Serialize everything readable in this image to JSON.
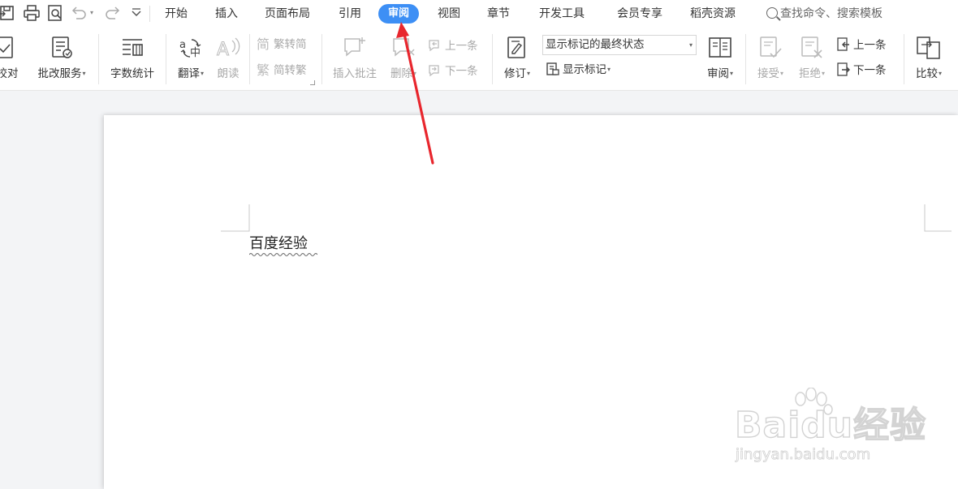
{
  "tabs": [
    {
      "label": "开始",
      "active": false
    },
    {
      "label": "插入",
      "active": false
    },
    {
      "label": "页面布局",
      "active": false
    },
    {
      "label": "引用",
      "active": false
    },
    {
      "label": "审阅",
      "active": true
    },
    {
      "label": "视图",
      "active": false
    },
    {
      "label": "章节",
      "active": false
    },
    {
      "label": "开发工具",
      "active": false
    },
    {
      "label": "会员专享",
      "active": false
    },
    {
      "label": "稻壳资源",
      "active": false
    }
  ],
  "search": {
    "placeholder": "查找命令、搜索模板"
  },
  "quick_access": [
    "save-icon",
    "print-icon",
    "print-preview-icon",
    "undo-icon",
    "redo-icon",
    "customize-icon"
  ],
  "ribbon": {
    "proofread": "校对",
    "revision_service": "批改服务",
    "word_count": "字数统计",
    "translate": "翻译",
    "read_aloud": "朗读",
    "trad_to_simp": "繁转简",
    "simp_to_trad": "简转繁",
    "insert_comment": "插入批注",
    "delete": "删除",
    "prev_comment": "上一条",
    "next_comment": "下一条",
    "track_changes": "修订",
    "markup_mode": "显示标记的最终状态",
    "show_markup": "显示标记",
    "review_pane": "审阅",
    "accept": "接受",
    "reject": "拒绝",
    "prev_change": "上一条",
    "next_change": "下一条",
    "compare": "比较"
  },
  "document": {
    "text": "百度经验"
  },
  "watermark": {
    "brand": "Baidu经验",
    "url": "jingyan.baidu.com"
  },
  "colors": {
    "active_tab": "#3d8ff5",
    "arrow": "#e8262d",
    "disabled_text": "#a8a8a8"
  }
}
